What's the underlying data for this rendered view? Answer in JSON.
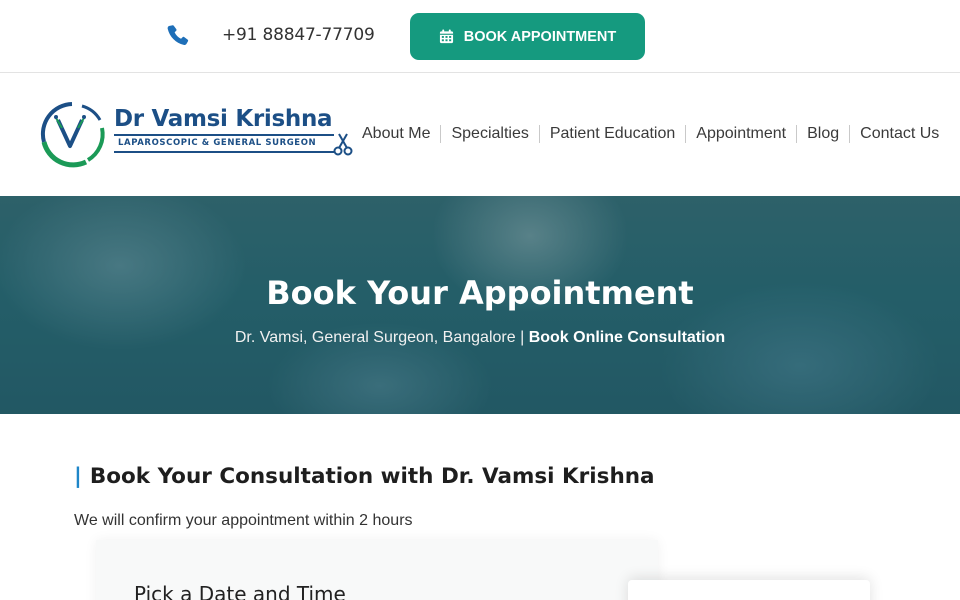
{
  "topbar": {
    "phone": "+91 88847-77709",
    "book_button": "BOOK APPOINTMENT"
  },
  "header": {
    "logo": {
      "title": "Dr Vamsi Krishna",
      "subtitle": "LAPAROSCOPIC & GENERAL SURGEON"
    },
    "nav": [
      "About Me",
      "Specialties",
      "Patient Education",
      "Appointment",
      "Blog",
      "Contact Us"
    ]
  },
  "hero": {
    "title": "Book Your Appointment",
    "breadcrumb_prefix": "Dr. Vamsi, General Surgeon, Bangalore",
    "breadcrumb_separator": "|",
    "breadcrumb_current": "Book Online Consultation"
  },
  "main": {
    "section_bar": "|",
    "section_title": "Book Your Consultation with Dr. Vamsi Krishna",
    "section_subtitle": "We will confirm your appointment within 2 hours",
    "card_title": "Pick a Date and Time"
  },
  "colors": {
    "accent_green": "#159a7f",
    "brand_blue": "#1c4f86",
    "title_bar_blue": "#1e86c8"
  },
  "icons": [
    "phone-icon",
    "calendar-icon",
    "logo-mark-icon",
    "scissors-icon"
  ]
}
